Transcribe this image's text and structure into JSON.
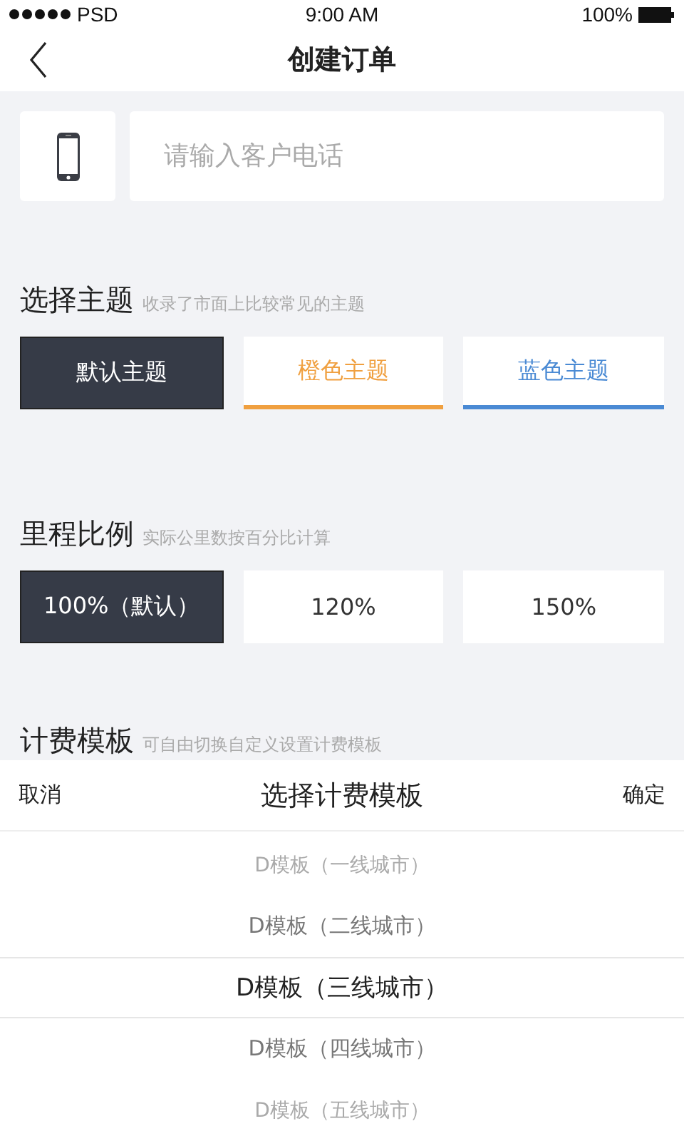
{
  "status_bar": {
    "carrier": "PSD",
    "time": "9:00 AM",
    "battery": "100%"
  },
  "nav": {
    "title": "创建订单"
  },
  "phone": {
    "placeholder": "请输入客户电话"
  },
  "theme": {
    "title": "选择主题",
    "hint": "收录了市面上比较常见的主题",
    "options": [
      {
        "label": "默认主题",
        "selected": true
      },
      {
        "label": "橙色主题",
        "selected": false,
        "color": "#f0a040"
      },
      {
        "label": "蓝色主题",
        "selected": false,
        "color": "#4a8ad4"
      }
    ]
  },
  "mileage": {
    "title": "里程比例",
    "hint": "实际公里数按百分比计算",
    "options": [
      {
        "label": "100%（默认）",
        "selected": true
      },
      {
        "label": "120%",
        "selected": false
      },
      {
        "label": "150%",
        "selected": false
      }
    ]
  },
  "billing": {
    "title": "计费模板",
    "hint": "可自由切换自定义设置计费模板"
  },
  "picker": {
    "cancel": "取消",
    "title": "选择计费模板",
    "confirm": "确定",
    "items": [
      {
        "label": "D模板（一线城市）",
        "selected": false
      },
      {
        "label": "D模板（二线城市）",
        "selected": false
      },
      {
        "label": "D模板（三线城市）",
        "selected": true
      },
      {
        "label": "D模板（四线城市）",
        "selected": false
      },
      {
        "label": "D模板（五线城市）",
        "selected": false
      }
    ]
  }
}
